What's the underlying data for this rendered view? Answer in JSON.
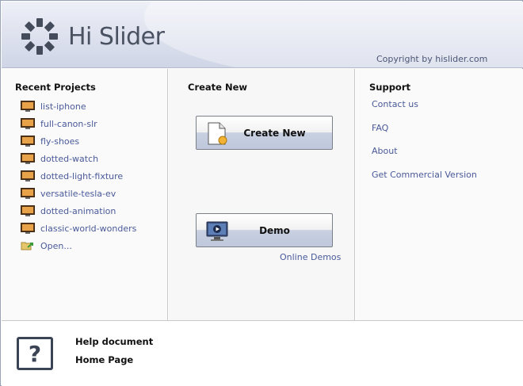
{
  "header": {
    "app_name": "Hi Slider",
    "copyright": "Copyright by hislider.com"
  },
  "recent": {
    "title": "Recent Projects",
    "items": [
      {
        "label": "list-iphone",
        "icon": "slideshow-project-icon"
      },
      {
        "label": "full-canon-slr",
        "icon": "slideshow-project-icon"
      },
      {
        "label": "fly-shoes",
        "icon": "slideshow-project-icon"
      },
      {
        "label": "dotted-watch",
        "icon": "slideshow-project-icon"
      },
      {
        "label": "dotted-light-fixture",
        "icon": "slideshow-project-icon"
      },
      {
        "label": "versatile-tesla-ev",
        "icon": "slideshow-project-icon"
      },
      {
        "label": "dotted-animation",
        "icon": "slideshow-project-icon"
      },
      {
        "label": "classic-world-wonders",
        "icon": "slideshow-project-icon"
      }
    ],
    "open_label": "Open..."
  },
  "create": {
    "title": "Create New",
    "create_button": "Create New",
    "demo_button": "Demo",
    "online_demos": "Online Demos"
  },
  "support": {
    "title": "Support",
    "items": [
      "Contact us",
      "FAQ",
      "About",
      "Get Commercial Version"
    ]
  },
  "footer": {
    "help_document": "Help document",
    "home_page": "Home Page"
  },
  "colors": {
    "link": "#4a5a9a",
    "header_bg": "#dde1ee",
    "button_bottom": "#bfc8dc"
  }
}
